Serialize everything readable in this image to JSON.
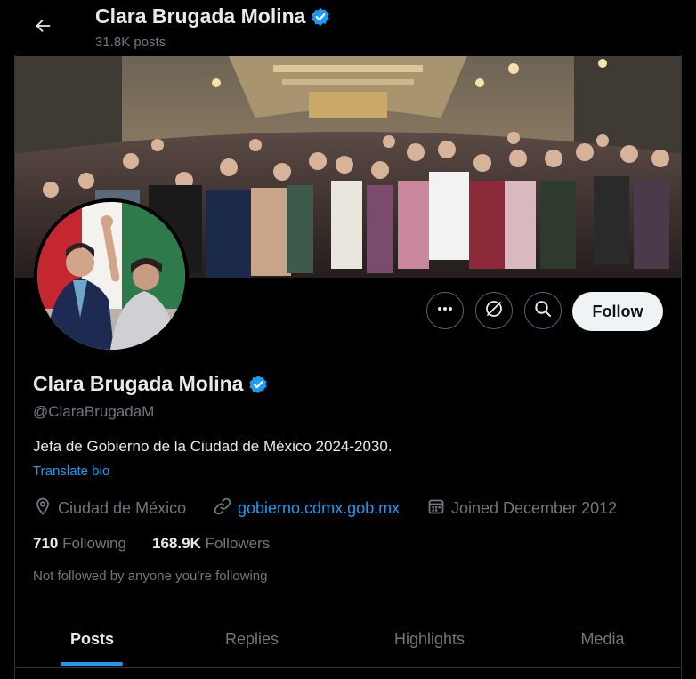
{
  "header": {
    "name": "Clara Brugada Molina",
    "posts_count": "31.8K posts"
  },
  "profile": {
    "name": "Clara Brugada Molina",
    "handle": "@ClaraBrugadaM",
    "bio": "Jefa de Gobierno de la Ciudad de México 2024-2030.",
    "translate_label": "Translate bio",
    "location": "Ciudad de México",
    "website": "gobierno.cdmx.gob.mx",
    "joined": "Joined December 2012",
    "following_count": "710",
    "following_label": "Following",
    "followers_count": "168.9K",
    "followers_label": "Followers",
    "not_followed": "Not followed by anyone you’re following"
  },
  "actions": {
    "follow_label": "Follow"
  },
  "tabs": [
    {
      "label": "Posts",
      "active": true
    },
    {
      "label": "Replies",
      "active": false
    },
    {
      "label": "Highlights",
      "active": false
    },
    {
      "label": "Media",
      "active": false
    }
  ],
  "icons": {
    "back": "arrow-left-icon",
    "verified": "verified-badge-icon",
    "more": "more-icon",
    "grok": "grok-icon",
    "search": "search-icon",
    "location": "location-pin-icon",
    "link": "link-icon",
    "calendar": "calendar-icon"
  },
  "colors": {
    "accent": "#1d9bf0",
    "background": "#000000",
    "text": "#e7e9ea",
    "muted": "#71767b",
    "verified": "#1d9bf0"
  }
}
